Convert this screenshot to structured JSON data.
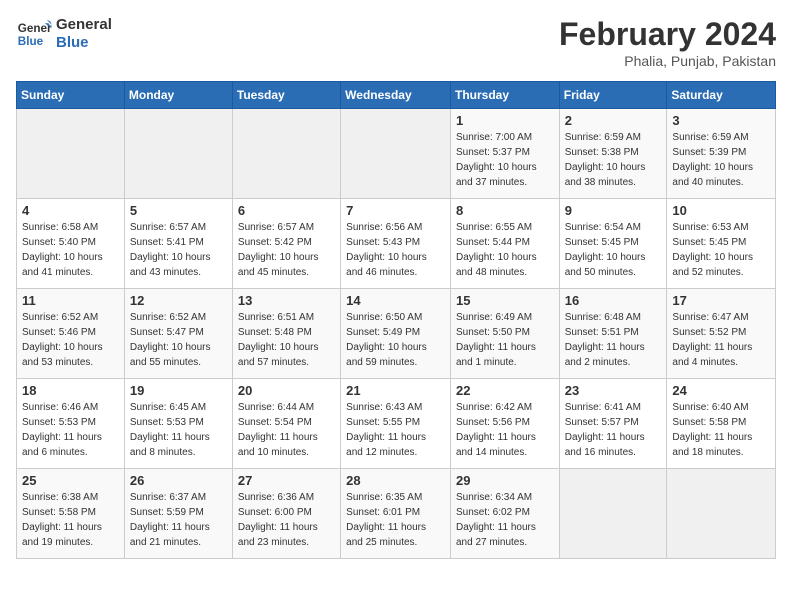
{
  "header": {
    "logo_general": "General",
    "logo_blue": "Blue",
    "month_title": "February 2024",
    "location": "Phalia, Punjab, Pakistan"
  },
  "weekdays": [
    "Sunday",
    "Monday",
    "Tuesday",
    "Wednesday",
    "Thursday",
    "Friday",
    "Saturday"
  ],
  "weeks": [
    [
      {
        "day": "",
        "sunrise": "",
        "sunset": "",
        "daylight": ""
      },
      {
        "day": "",
        "sunrise": "",
        "sunset": "",
        "daylight": ""
      },
      {
        "day": "",
        "sunrise": "",
        "sunset": "",
        "daylight": ""
      },
      {
        "day": "",
        "sunrise": "",
        "sunset": "",
        "daylight": ""
      },
      {
        "day": "1",
        "sunrise": "Sunrise: 7:00 AM",
        "sunset": "Sunset: 5:37 PM",
        "daylight": "Daylight: 10 hours and 37 minutes."
      },
      {
        "day": "2",
        "sunrise": "Sunrise: 6:59 AM",
        "sunset": "Sunset: 5:38 PM",
        "daylight": "Daylight: 10 hours and 38 minutes."
      },
      {
        "day": "3",
        "sunrise": "Sunrise: 6:59 AM",
        "sunset": "Sunset: 5:39 PM",
        "daylight": "Daylight: 10 hours and 40 minutes."
      }
    ],
    [
      {
        "day": "4",
        "sunrise": "Sunrise: 6:58 AM",
        "sunset": "Sunset: 5:40 PM",
        "daylight": "Daylight: 10 hours and 41 minutes."
      },
      {
        "day": "5",
        "sunrise": "Sunrise: 6:57 AM",
        "sunset": "Sunset: 5:41 PM",
        "daylight": "Daylight: 10 hours and 43 minutes."
      },
      {
        "day": "6",
        "sunrise": "Sunrise: 6:57 AM",
        "sunset": "Sunset: 5:42 PM",
        "daylight": "Daylight: 10 hours and 45 minutes."
      },
      {
        "day": "7",
        "sunrise": "Sunrise: 6:56 AM",
        "sunset": "Sunset: 5:43 PM",
        "daylight": "Daylight: 10 hours and 46 minutes."
      },
      {
        "day": "8",
        "sunrise": "Sunrise: 6:55 AM",
        "sunset": "Sunset: 5:44 PM",
        "daylight": "Daylight: 10 hours and 48 minutes."
      },
      {
        "day": "9",
        "sunrise": "Sunrise: 6:54 AM",
        "sunset": "Sunset: 5:45 PM",
        "daylight": "Daylight: 10 hours and 50 minutes."
      },
      {
        "day": "10",
        "sunrise": "Sunrise: 6:53 AM",
        "sunset": "Sunset: 5:45 PM",
        "daylight": "Daylight: 10 hours and 52 minutes."
      }
    ],
    [
      {
        "day": "11",
        "sunrise": "Sunrise: 6:52 AM",
        "sunset": "Sunset: 5:46 PM",
        "daylight": "Daylight: 10 hours and 53 minutes."
      },
      {
        "day": "12",
        "sunrise": "Sunrise: 6:52 AM",
        "sunset": "Sunset: 5:47 PM",
        "daylight": "Daylight: 10 hours and 55 minutes."
      },
      {
        "day": "13",
        "sunrise": "Sunrise: 6:51 AM",
        "sunset": "Sunset: 5:48 PM",
        "daylight": "Daylight: 10 hours and 57 minutes."
      },
      {
        "day": "14",
        "sunrise": "Sunrise: 6:50 AM",
        "sunset": "Sunset: 5:49 PM",
        "daylight": "Daylight: 10 hours and 59 minutes."
      },
      {
        "day": "15",
        "sunrise": "Sunrise: 6:49 AM",
        "sunset": "Sunset: 5:50 PM",
        "daylight": "Daylight: 11 hours and 1 minute."
      },
      {
        "day": "16",
        "sunrise": "Sunrise: 6:48 AM",
        "sunset": "Sunset: 5:51 PM",
        "daylight": "Daylight: 11 hours and 2 minutes."
      },
      {
        "day": "17",
        "sunrise": "Sunrise: 6:47 AM",
        "sunset": "Sunset: 5:52 PM",
        "daylight": "Daylight: 11 hours and 4 minutes."
      }
    ],
    [
      {
        "day": "18",
        "sunrise": "Sunrise: 6:46 AM",
        "sunset": "Sunset: 5:53 PM",
        "daylight": "Daylight: 11 hours and 6 minutes."
      },
      {
        "day": "19",
        "sunrise": "Sunrise: 6:45 AM",
        "sunset": "Sunset: 5:53 PM",
        "daylight": "Daylight: 11 hours and 8 minutes."
      },
      {
        "day": "20",
        "sunrise": "Sunrise: 6:44 AM",
        "sunset": "Sunset: 5:54 PM",
        "daylight": "Daylight: 11 hours and 10 minutes."
      },
      {
        "day": "21",
        "sunrise": "Sunrise: 6:43 AM",
        "sunset": "Sunset: 5:55 PM",
        "daylight": "Daylight: 11 hours and 12 minutes."
      },
      {
        "day": "22",
        "sunrise": "Sunrise: 6:42 AM",
        "sunset": "Sunset: 5:56 PM",
        "daylight": "Daylight: 11 hours and 14 minutes."
      },
      {
        "day": "23",
        "sunrise": "Sunrise: 6:41 AM",
        "sunset": "Sunset: 5:57 PM",
        "daylight": "Daylight: 11 hours and 16 minutes."
      },
      {
        "day": "24",
        "sunrise": "Sunrise: 6:40 AM",
        "sunset": "Sunset: 5:58 PM",
        "daylight": "Daylight: 11 hours and 18 minutes."
      }
    ],
    [
      {
        "day": "25",
        "sunrise": "Sunrise: 6:38 AM",
        "sunset": "Sunset: 5:58 PM",
        "daylight": "Daylight: 11 hours and 19 minutes."
      },
      {
        "day": "26",
        "sunrise": "Sunrise: 6:37 AM",
        "sunset": "Sunset: 5:59 PM",
        "daylight": "Daylight: 11 hours and 21 minutes."
      },
      {
        "day": "27",
        "sunrise": "Sunrise: 6:36 AM",
        "sunset": "Sunset: 6:00 PM",
        "daylight": "Daylight: 11 hours and 23 minutes."
      },
      {
        "day": "28",
        "sunrise": "Sunrise: 6:35 AM",
        "sunset": "Sunset: 6:01 PM",
        "daylight": "Daylight: 11 hours and 25 minutes."
      },
      {
        "day": "29",
        "sunrise": "Sunrise: 6:34 AM",
        "sunset": "Sunset: 6:02 PM",
        "daylight": "Daylight: 11 hours and 27 minutes."
      },
      {
        "day": "",
        "sunrise": "",
        "sunset": "",
        "daylight": ""
      },
      {
        "day": "",
        "sunrise": "",
        "sunset": "",
        "daylight": ""
      }
    ]
  ]
}
